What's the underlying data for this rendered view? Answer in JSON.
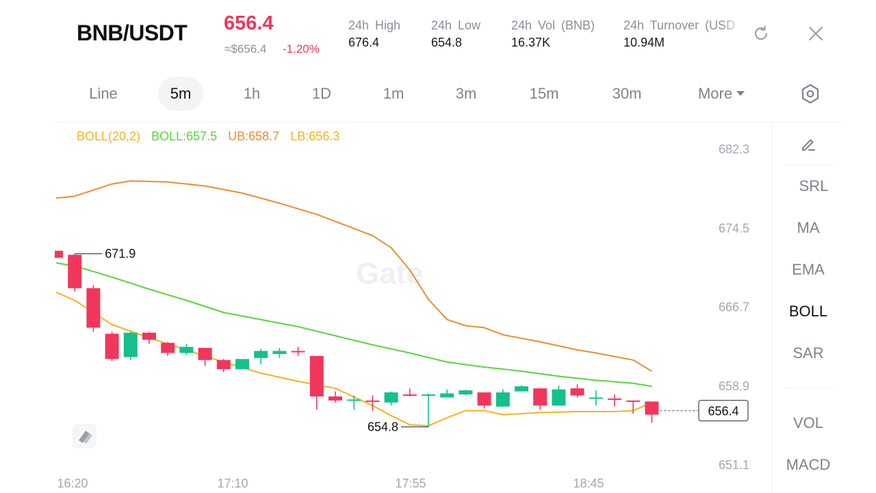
{
  "header": {
    "pair": "BNB/USDT",
    "price": "656.4",
    "usd_price": "≈$656.4",
    "change": "-1.20%",
    "stats": [
      {
        "label": "24h High",
        "value": "676.4"
      },
      {
        "label": "24h Low",
        "value": "654.8"
      },
      {
        "label": "24h Vol (BNB)",
        "value": "16.37K"
      },
      {
        "label": "24h Turnover (USD",
        "value": "10.94M"
      }
    ],
    "refresh_icon": "refresh-icon",
    "close_icon": "close-icon"
  },
  "tabs": {
    "items": [
      "Line",
      "5m",
      "1h",
      "1D",
      "1m",
      "3m",
      "15m",
      "30m",
      "More"
    ],
    "active": "5m",
    "settings_icon": "hexagon-settings-icon"
  },
  "legend": {
    "boll": "BOLL(20,2)",
    "mid": "BOLL:657.5",
    "ub": "UB:658.7",
    "lb": "LB:656.3"
  },
  "colors": {
    "up": "#14c08b",
    "down": "#f0375b",
    "mid_line": "#5ad43a",
    "ub_line": "#e98f2a",
    "lb_line": "#f2b51a",
    "price_red": "#f0375b"
  },
  "chart_data": {
    "type": "candlestick",
    "y_ticks": [
      "682.3",
      "674.5",
      "666.7",
      "658.9",
      "651.1"
    ],
    "x_ticks": [
      "16:20",
      "17:10",
      "17:55",
      "18:45"
    ],
    "ylim": [
      651.1,
      682.3
    ],
    "high_label": "671.9",
    "low_label": "654.8",
    "last_price_label": "656.4",
    "watermark": "Gate",
    "candles": [
      {
        "o": 672.2,
        "c": 671.5,
        "h": 672.2,
        "l": 671.5
      },
      {
        "o": 671.8,
        "c": 668.5,
        "h": 671.9,
        "l": 668.2
      },
      {
        "o": 668.5,
        "c": 664.6,
        "h": 668.8,
        "l": 664.2
      },
      {
        "o": 664.0,
        "c": 661.5,
        "h": 664.2,
        "l": 661.3
      },
      {
        "o": 661.7,
        "c": 664.1,
        "h": 664.2,
        "l": 661.4
      },
      {
        "o": 664.1,
        "c": 663.4,
        "h": 664.2,
        "l": 663.0
      },
      {
        "o": 663.1,
        "c": 662.1,
        "h": 663.2,
        "l": 661.8
      },
      {
        "o": 662.1,
        "c": 662.7,
        "h": 663.0,
        "l": 661.9
      },
      {
        "o": 662.6,
        "c": 661.4,
        "h": 662.6,
        "l": 660.8
      },
      {
        "o": 661.4,
        "c": 660.5,
        "h": 661.5,
        "l": 660.2
      },
      {
        "o": 660.5,
        "c": 661.5,
        "h": 661.5,
        "l": 660.5
      },
      {
        "o": 661.6,
        "c": 662.3,
        "h": 662.5,
        "l": 661.0
      },
      {
        "o": 662.0,
        "c": 662.3,
        "h": 662.6,
        "l": 661.6
      },
      {
        "o": 662.3,
        "c": 662.2,
        "h": 662.7,
        "l": 661.8
      },
      {
        "o": 661.8,
        "c": 657.8,
        "h": 661.8,
        "l": 656.5
      },
      {
        "o": 657.8,
        "c": 657.4,
        "h": 658.3,
        "l": 657.2
      },
      {
        "o": 657.4,
        "c": 657.5,
        "h": 657.9,
        "l": 656.5
      },
      {
        "o": 657.4,
        "c": 657.3,
        "h": 657.9,
        "l": 656.4
      },
      {
        "o": 657.2,
        "c": 658.2,
        "h": 658.3,
        "l": 656.9
      },
      {
        "o": 658.0,
        "c": 657.9,
        "h": 658.6,
        "l": 657.8
      },
      {
        "o": 657.9,
        "c": 658.0,
        "h": 658.1,
        "l": 654.8
      },
      {
        "o": 657.7,
        "c": 658.1,
        "h": 658.5,
        "l": 657.7
      },
      {
        "o": 658.0,
        "c": 658.4,
        "h": 658.5,
        "l": 657.9
      },
      {
        "o": 658.2,
        "c": 656.9,
        "h": 658.2,
        "l": 656.6
      },
      {
        "o": 656.8,
        "c": 658.2,
        "h": 658.5,
        "l": 656.8
      },
      {
        "o": 658.3,
        "c": 658.8,
        "h": 658.9,
        "l": 658.3
      },
      {
        "o": 658.6,
        "c": 656.9,
        "h": 658.6,
        "l": 656.5
      },
      {
        "o": 656.9,
        "c": 658.5,
        "h": 658.9,
        "l": 656.9
      },
      {
        "o": 658.6,
        "c": 657.9,
        "h": 659.0,
        "l": 657.7
      },
      {
        "o": 657.7,
        "c": 657.7,
        "h": 658.4,
        "l": 656.9
      },
      {
        "o": 657.6,
        "c": 657.5,
        "h": 658.0,
        "l": 656.8
      },
      {
        "o": 657.4,
        "c": 657.3,
        "h": 657.4,
        "l": 656.1
      },
      {
        "o": 657.3,
        "c": 656.0,
        "h": 657.3,
        "l": 655.2
      }
    ],
    "boll_ub": [
      [
        0,
        677.4
      ],
      [
        1,
        677.6
      ],
      [
        3,
        678.8
      ],
      [
        4,
        679.1
      ],
      [
        6,
        679.0
      ],
      [
        8,
        678.6
      ],
      [
        10,
        677.9
      ],
      [
        12,
        676.9
      ],
      [
        14,
        675.8
      ],
      [
        15,
        675.1
      ],
      [
        17,
        673.7
      ],
      [
        18,
        672.5
      ],
      [
        19,
        670.3
      ],
      [
        20,
        667.4
      ],
      [
        21,
        665.4
      ],
      [
        22,
        664.8
      ],
      [
        23,
        664.6
      ],
      [
        24,
        663.9
      ],
      [
        26,
        663.2
      ],
      [
        27,
        662.8
      ],
      [
        28,
        662.4
      ],
      [
        29,
        662.1
      ],
      [
        31,
        661.4
      ],
      [
        32,
        660.3
      ]
    ],
    "boll_mid": [
      [
        0,
        671.0
      ],
      [
        1,
        670.7
      ],
      [
        3,
        669.6
      ],
      [
        5,
        668.4
      ],
      [
        7,
        667.3
      ],
      [
        9,
        666.1
      ],
      [
        11,
        665.4
      ],
      [
        13,
        664.7
      ],
      [
        15,
        663.8
      ],
      [
        17,
        662.9
      ],
      [
        19,
        662.1
      ],
      [
        21,
        661.2
      ],
      [
        23,
        660.7
      ],
      [
        25,
        660.3
      ],
      [
        27,
        659.8
      ],
      [
        29,
        659.4
      ],
      [
        31,
        659.1
      ],
      [
        32,
        658.8
      ]
    ],
    "boll_lb": [
      [
        0,
        668.1
      ],
      [
        1,
        667.3
      ],
      [
        2,
        666.1
      ],
      [
        3,
        664.9
      ],
      [
        5,
        663.6
      ],
      [
        7,
        662.4
      ],
      [
        9,
        661.2
      ],
      [
        11,
        660.1
      ],
      [
        13,
        659.3
      ],
      [
        15,
        658.6
      ],
      [
        17,
        656.9
      ],
      [
        18,
        655.9
      ],
      [
        19,
        655.0
      ],
      [
        20,
        654.9
      ],
      [
        21,
        655.7
      ],
      [
        22,
        656.4
      ],
      [
        23,
        656.4
      ],
      [
        24,
        656.0
      ],
      [
        26,
        656.2
      ],
      [
        28,
        656.3
      ],
      [
        30,
        656.3
      ],
      [
        31,
        656.4
      ],
      [
        32,
        657.2
      ]
    ]
  },
  "side_panel": {
    "items": [
      "SRL",
      "MA",
      "EMA",
      "BOLL",
      "SAR",
      "VOL",
      "MACD"
    ],
    "active": "BOLL",
    "draw_icon": "pencil-icon"
  }
}
